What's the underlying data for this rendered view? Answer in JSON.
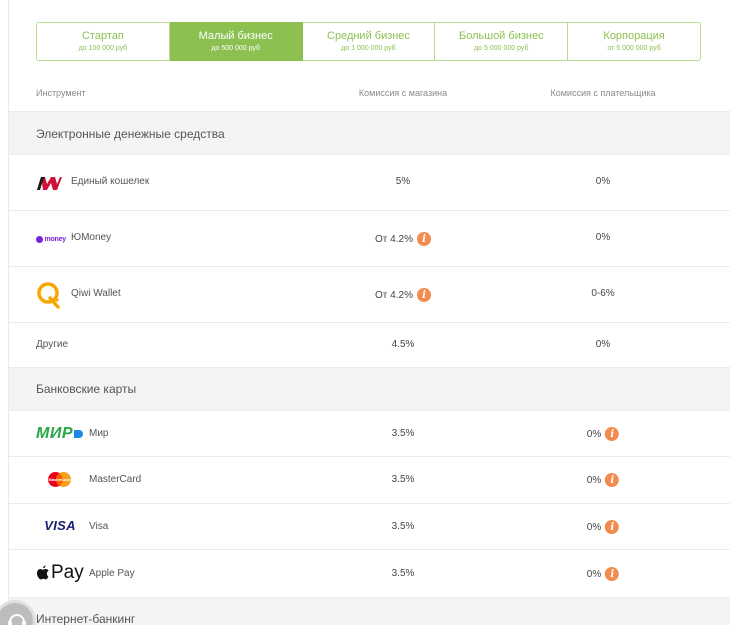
{
  "plans": [
    {
      "name": "Стартап",
      "limit": "до 100 000 руб"
    },
    {
      "name": "Малый бизнес",
      "limit": "до 500 000 руб",
      "active": true
    },
    {
      "name": "Средний бизнес",
      "limit": "до 1 000 000 руб"
    },
    {
      "name": "Большой бизнес",
      "limit": "до 5 000 000 руб"
    },
    {
      "name": "Корпорация",
      "limit": "от 5 000 000 руб"
    }
  ],
  "columns": {
    "instrument": "Инструмент",
    "shop_fee": "Комиссия с магазина",
    "payer_fee": "Комиссия с плательщика"
  },
  "sections": {
    "emoney": "Электронные денежные средства",
    "cards": "Банковские карты",
    "banking": "Интернет-банкинг"
  },
  "rows": [
    {
      "name": "Единый кошелек",
      "shop_fee": "5%",
      "payer_fee": "0%",
      "icon": "wallet-one-logo"
    },
    {
      "name": "ЮMoney",
      "shop_fee": "От 4.2%",
      "payer_fee": "0%",
      "icon": "yoomoney-logo",
      "logo_text": "money"
    },
    {
      "name": "Qiwi Wallet",
      "shop_fee": "От 4.2%",
      "payer_fee": "0-6%",
      "icon": "qiwi-logo"
    },
    {
      "name": "Другие",
      "shop_fee": "4.5%",
      "payer_fee": "0%"
    },
    {
      "name": "Мир",
      "shop_fee": "3.5%",
      "payer_fee": "0%",
      "icon": "mir-logo",
      "logo_text": "МИР"
    },
    {
      "name": "MasterCard",
      "shop_fee": "3.5%",
      "payer_fee": "0%",
      "icon": "mastercard-logo",
      "logo_text": "MasterCard"
    },
    {
      "name": "Visa",
      "shop_fee": "3.5%",
      "payer_fee": "0%",
      "icon": "visa-logo",
      "logo_text": "VISA"
    },
    {
      "name": "Apple Pay",
      "shop_fee": "3.5%",
      "payer_fee": "0%",
      "icon": "apple-pay-logo",
      "logo_text": "Pay"
    }
  ],
  "info_glyph": "i",
  "colors": {
    "accent": "#8cc152",
    "info": "#f28c4e",
    "section_bg": "#f4f4f4"
  }
}
